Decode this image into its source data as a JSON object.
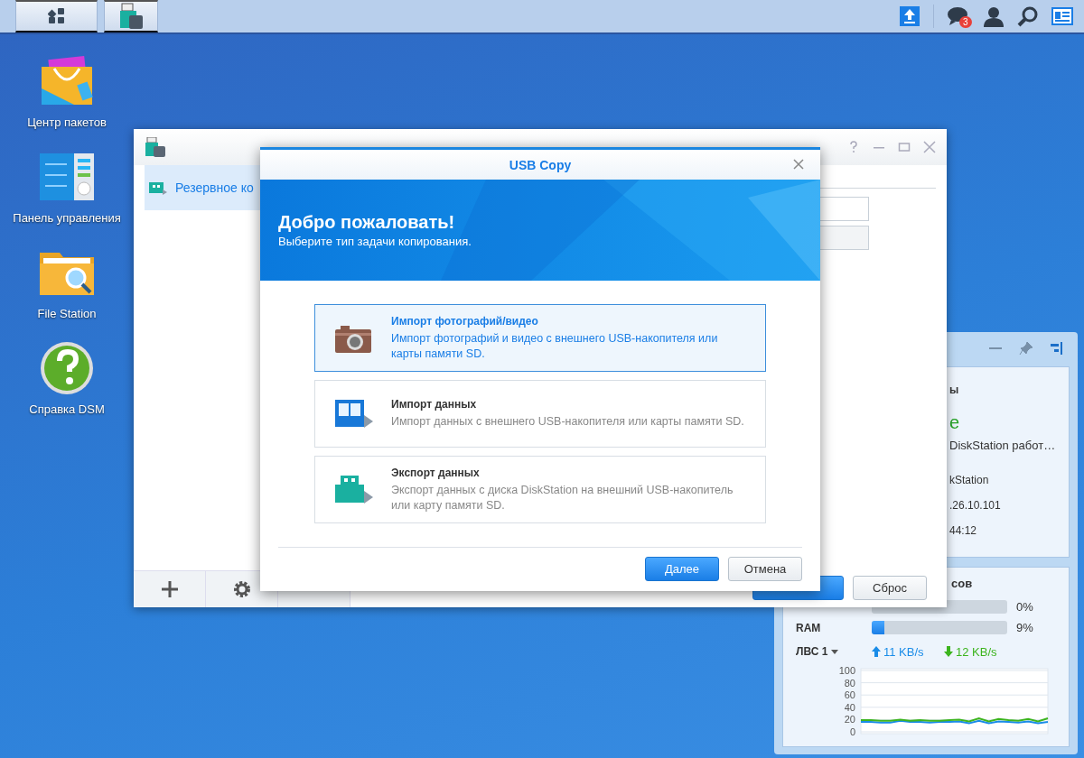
{
  "taskbar": {
    "notification_count": "3"
  },
  "desktop_icons": [
    {
      "kind": "package",
      "label": "Центр пакетов"
    },
    {
      "kind": "control",
      "label": "Панель управления"
    },
    {
      "kind": "folder",
      "label": "File Station"
    },
    {
      "kind": "help",
      "label": "Справка DSM"
    }
  ],
  "app_window": {
    "sidebar": [
      {
        "label": "Резервное ко",
        "selected": true
      }
    ],
    "buttons": [
      {
        "label": "Сброс"
      }
    ]
  },
  "widget": {
    "info": {
      "heading": "ы",
      "status": "е",
      "status_text": "DiskStation работ…",
      "lines": [
        "kStation",
        ".26.10.101",
        "44:12"
      ]
    },
    "resources": {
      "heading": "сов",
      "meters": [
        {
          "level": 0,
          "reading": "0%"
        },
        {
          "label": "RAM",
          "level": 0.09,
          "reading": "9%"
        }
      ],
      "network": {
        "label": "ЛВС 1",
        "upload": "11 KB/s",
        "download": "12 KB/s"
      },
      "chart_data": {
        "type": "line",
        "grid": true,
        "ylim": [
          0,
          100
        ],
        "yticks": [
          0,
          20,
          40,
          60,
          80,
          100
        ],
        "series": [
          {
            "color": "#1a8ce8",
            "values": [
              16,
              16,
              15,
              15,
              18,
              16,
              16,
              15,
              16,
              16,
              17,
              14,
              18,
              14,
              17,
              16,
              15,
              17,
              14,
              16
            ]
          },
          {
            "color": "#3cb41e",
            "values": [
              19,
              19,
              18,
              18,
              20,
              18,
              19,
              18,
              18,
              19,
              20,
              17,
              22,
              17,
              21,
              19,
              18,
              21,
              17,
              22
            ]
          }
        ]
      }
    }
  },
  "dialog": {
    "title": "USB Copy",
    "heading": "Добро пожаловать!",
    "subtitle": "Выберите тип задачи копирования.",
    "options": [
      {
        "kind": "camera",
        "title": "Импорт фотографий/видео",
        "description": "Импорт фотографий и видео с внешнего USB-накопителя или карты памяти SD.",
        "selected": true
      },
      {
        "kind": "import",
        "title": "Импорт данных",
        "description": "Импорт данных с внешнего USB-накопителя или карты памяти SD.",
        "selected": false
      },
      {
        "kind": "export",
        "title": "Экспорт данных",
        "description": "Экспорт данных с диска DiskStation на внешний USB-накопитель или карту памяти SD.",
        "selected": false
      }
    ],
    "buttons": [
      {
        "label": "Далее",
        "primary": true
      },
      {
        "label": "Отмена",
        "primary": false
      }
    ]
  }
}
